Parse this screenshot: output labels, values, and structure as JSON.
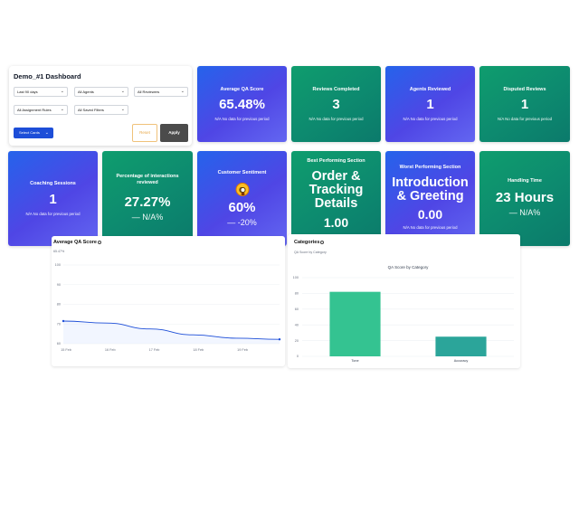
{
  "filters": {
    "dashboard_title": "Demo_#1 Dashboard",
    "date_range": "Last 90 days",
    "agents": "All Agents",
    "reviewers": "All Reviewers",
    "assignment_rules": "All Assignment Rules",
    "saved_filters": "All Saved Filters",
    "select_cards": "Select Cards",
    "reset": "Reset",
    "apply": "Apply"
  },
  "cards": {
    "avg_qa": {
      "title": "Average QA Score",
      "value": "65.48%",
      "sub": "N/A  No data for previous period"
    },
    "reviews_completed": {
      "title": "Reviews Completed",
      "value": "3",
      "sub": "N/A  No data for previous period"
    },
    "agents_reviewed": {
      "title": "Agents Reviewed",
      "value": "1",
      "sub": "N/A  No data for previous period"
    },
    "disputed_reviews": {
      "title": "Disputed Reviews",
      "value": "1",
      "sub": "N/A  No data for previous period"
    },
    "coaching_sessions": {
      "title": "Coaching Sessions",
      "value": "1",
      "sub": "N/A  No data for previous period"
    },
    "pct_reviewed": {
      "title": "Percentage of interactions reviewed",
      "value": "27.27%",
      "delta": "— N/A%"
    },
    "sentiment": {
      "title": "Customer Sentiment",
      "value": "60%",
      "delta": "— -20%",
      "icon": "flushed-face-icon"
    },
    "best_section": {
      "title": "Best Performing Section",
      "name": "Order & Tracking Details",
      "value": "1.00"
    },
    "worst_section": {
      "title": "Worst Performing Section",
      "name": "Introduction & Greeting",
      "value": "0.00",
      "sub": "N/A  No data for previous period"
    },
    "handling_time": {
      "title": "Handling Time",
      "value": "23 Hours",
      "delta": "— N/A%"
    }
  },
  "avg_qa_panel": {
    "title": "Average QA Score",
    "subtitle": "65.47%"
  },
  "categories_panel": {
    "title": "Categories",
    "subtitle": "QA Score by Category"
  },
  "colors": {
    "blue_card": "#3b5bf0",
    "green_card": "#0f8f6f",
    "line": "#1d4ed8",
    "bar1": "#34c391",
    "bar2": "#2ba59a"
  },
  "chart_data": [
    {
      "type": "line",
      "title": "",
      "x": [
        "15 Feb",
        "16 Feb",
        "17 Feb",
        "18 Feb",
        "19 Feb"
      ],
      "x_values": [
        0,
        1,
        2,
        3,
        4,
        5
      ],
      "y_values": [
        71.5,
        70.5,
        67.5,
        64.5,
        62.8,
        62.2
      ],
      "yticks": [
        60,
        70,
        80,
        90,
        100
      ],
      "ylim": [
        60,
        100
      ],
      "grid": true
    },
    {
      "type": "bar",
      "title": "QA Score by Category",
      "categories": [
        "Tone",
        "Accuracy"
      ],
      "values": [
        82,
        25
      ],
      "yticks": [
        0,
        20,
        40,
        60,
        80,
        100
      ],
      "ylim": [
        0,
        100
      ],
      "grid": true
    }
  ]
}
